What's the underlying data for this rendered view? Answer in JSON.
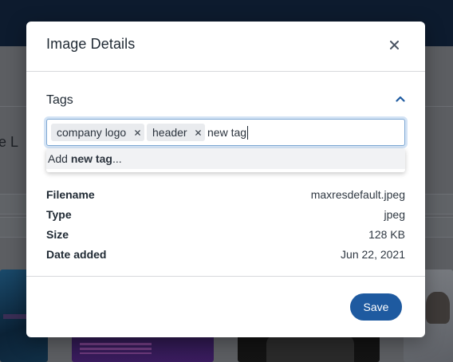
{
  "background": {
    "heading_fragment": "ge L"
  },
  "modal": {
    "title": "Image Details",
    "close_icon": "close-icon",
    "tags_section": {
      "label": "Tags",
      "collapse_icon": "chevron-up-icon",
      "chips": [
        {
          "label": "company logo",
          "remove_icon": "close-icon"
        },
        {
          "label": "header",
          "remove_icon": "close-icon"
        }
      ],
      "input_value": "new tag",
      "suggestion": {
        "prefix": "Add ",
        "bold": "new tag",
        "suffix": "..."
      }
    },
    "details": {
      "filename": {
        "label": "Filename",
        "value": "maxresdefault.jpeg"
      },
      "type": {
        "label": "Type",
        "value": "jpeg"
      },
      "size": {
        "label": "Size",
        "value": "128 KB"
      },
      "date_added": {
        "label": "Date added",
        "value": "Jun 22, 2021"
      }
    },
    "save_label": "Save"
  },
  "colors": {
    "primary": "#1e5aa0",
    "chevron": "#1e5aa0",
    "focus_ring": "#d3e3f5",
    "chip_bg": "#e9ebee",
    "topbar": "#0d1b2e"
  }
}
